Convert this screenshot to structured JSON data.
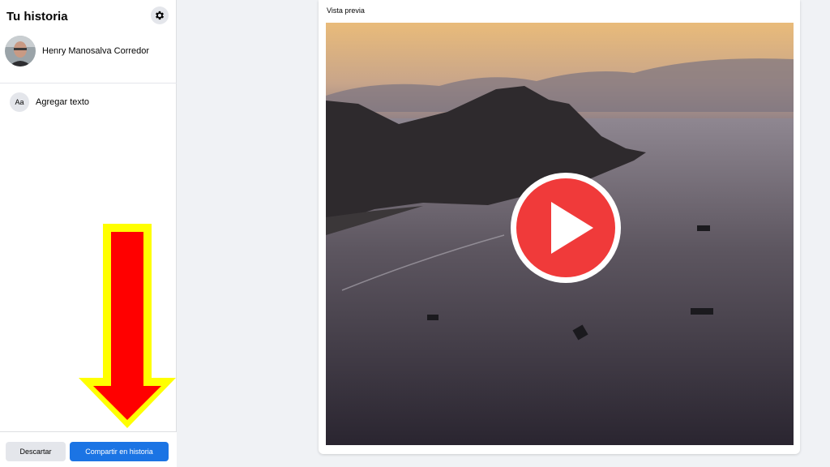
{
  "sidebar": {
    "title": "Tu historia",
    "settings_icon": "gear-icon",
    "user_name": "Henry Manosalva Corredor",
    "add_text_icon_label": "Aa",
    "add_text_label": "Agregar texto"
  },
  "footer": {
    "discard_label": "Descartar",
    "share_label": "Compartir en historia"
  },
  "preview": {
    "label": "Vista previa",
    "play_icon": "play-icon"
  },
  "colors": {
    "accent": "#1b74e4",
    "arrow_fill": "#ff0000",
    "arrow_outline": "#ffff00",
    "play": "#f03a3a"
  }
}
